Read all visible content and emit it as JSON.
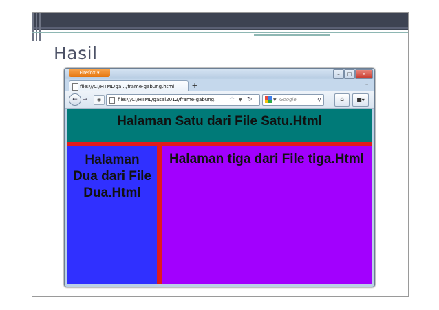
{
  "slide": {
    "title": "Hasil"
  },
  "browser": {
    "app_button": "Firefox ▾",
    "tab_label": "file:///C:/HTML/ga.../frame-gabung.html",
    "url": "file:///C:/HTML/gasal2012/frame-gabung.",
    "search_placeholder": "Google"
  },
  "frames": {
    "top_heading": "Halaman Satu dari File Satu.Html",
    "left_heading": "Halaman Dua dari File Dua.Html",
    "right_heading": "Halaman tiga dari File tiga.Html"
  },
  "colors": {
    "frame_top_bg": "#007a78",
    "frame_left_bg": "#3030ff",
    "frame_right_bg": "#a200fe",
    "frame_border": "#e01b1b",
    "firefox_button": "#e4750e"
  }
}
